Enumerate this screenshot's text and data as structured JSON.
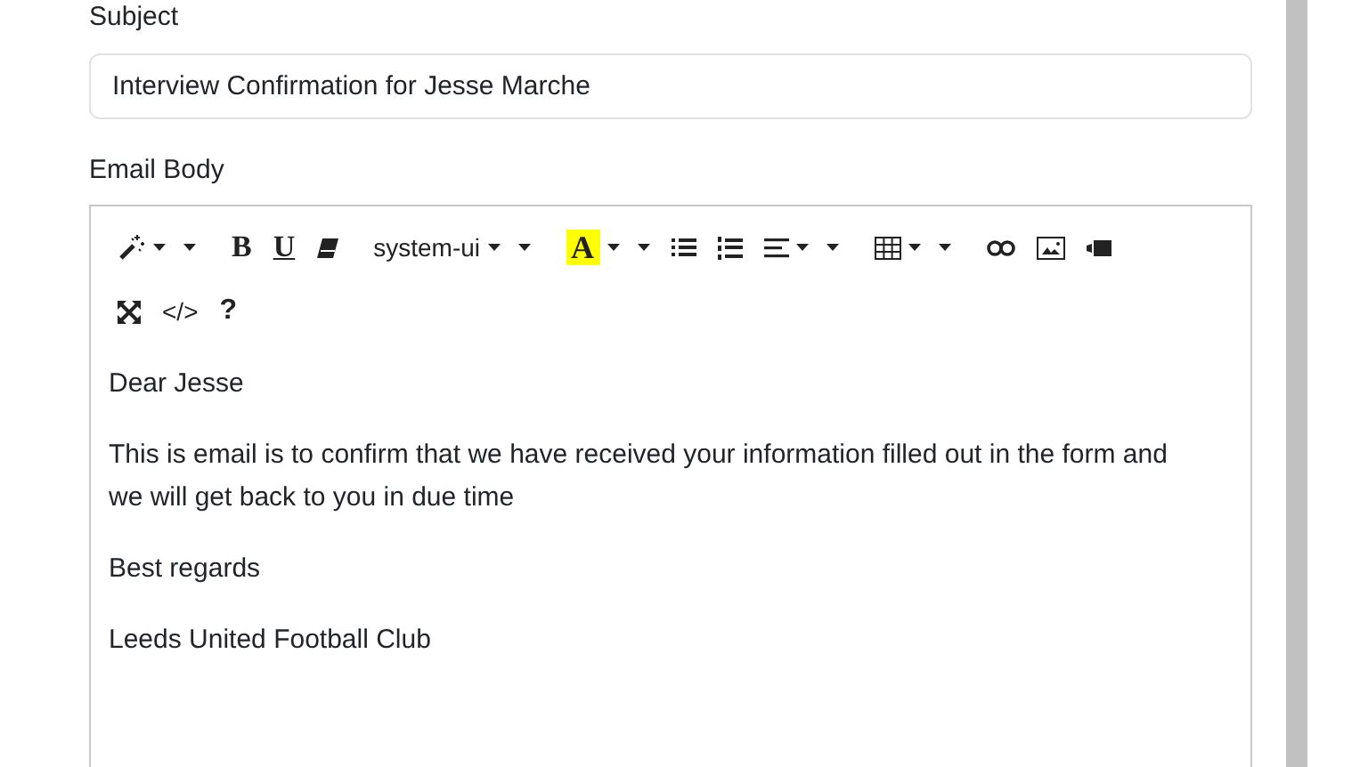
{
  "subject": {
    "label": "Subject",
    "value": "Interview Confirmation for Jesse Marche"
  },
  "body_label": "Email Body",
  "toolbar": [
    [
      {
        "kind": "magic",
        "dropdown": true
      },
      {
        "kind": "bold",
        "text": "B"
      },
      {
        "kind": "underline",
        "text": "U"
      },
      {
        "kind": "eraser"
      },
      {
        "kind": "font",
        "text": "system-ui",
        "dropdown": true
      },
      {
        "kind": "color",
        "text": "A",
        "dropdown": true
      },
      {
        "kind": "ul"
      },
      {
        "kind": "ol"
      },
      {
        "kind": "align",
        "dropdown": true
      },
      {
        "kind": "table",
        "dropdown": true
      },
      {
        "kind": "link"
      },
      {
        "kind": "picture"
      },
      {
        "kind": "video"
      }
    ],
    [
      {
        "kind": "fullscreen"
      },
      {
        "kind": "code",
        "text": "</>"
      },
      {
        "kind": "help",
        "text": "?"
      }
    ]
  ],
  "body": [
    "Dear Jesse",
    "This is email is to confirm that we have received your information filled out in the form and we will get back to you in due time",
    "Best regards",
    "Leeds United Football Club"
  ]
}
